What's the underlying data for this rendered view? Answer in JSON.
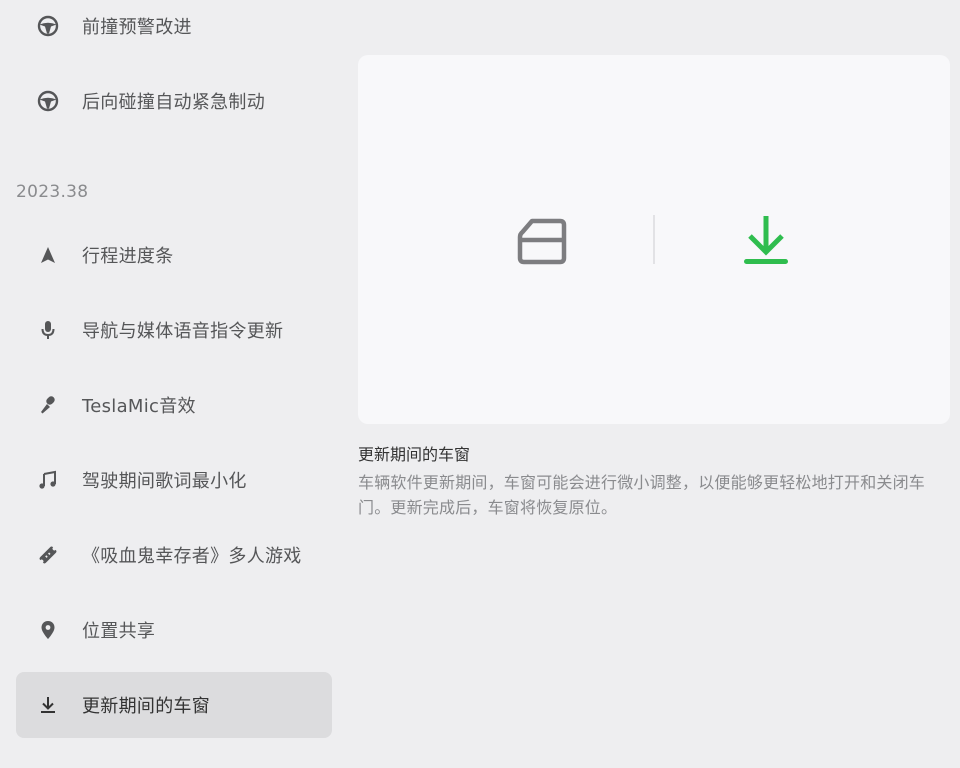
{
  "sidebar": {
    "items_top": [
      {
        "label": "前撞预警改进",
        "icon": "steering-wheel-icon"
      },
      {
        "label": "后向碰撞自动紧急制动",
        "icon": "steering-wheel-icon"
      }
    ],
    "version": "2023.38",
    "items": [
      {
        "label": "行程进度条",
        "icon": "navigation-arrow-icon"
      },
      {
        "label": "导航与媒体语音指令更新",
        "icon": "microphone-icon"
      },
      {
        "label": "TeslaMic音效",
        "icon": "pen-mic-icon"
      },
      {
        "label": "驾驶期间歌词最小化",
        "icon": "music-note-icon"
      },
      {
        "label": "《吸血鬼幸存者》多人游戏",
        "icon": "game-ticket-icon"
      },
      {
        "label": "位置共享",
        "icon": "location-pin-icon"
      },
      {
        "label": "更新期间的车窗",
        "icon": "download-icon",
        "active": true
      }
    ]
  },
  "detail": {
    "title": "更新期间的车窗",
    "description": "车辆软件更新期间，车窗可能会进行微小调整，以便能够更轻松地打开和关闭车门。更新完成后，车窗将恢复原位。",
    "preview_icons": [
      "car-window-icon",
      "download-icon"
    ]
  },
  "colors": {
    "background": "#eeeef0",
    "card": "#f8f8fa",
    "active_item": "#dcdcde",
    "icon_gray": "#555658",
    "window_icon": "#7d7d80",
    "accent_green": "#2fbd4e",
    "muted_text": "#8a8b8e"
  }
}
